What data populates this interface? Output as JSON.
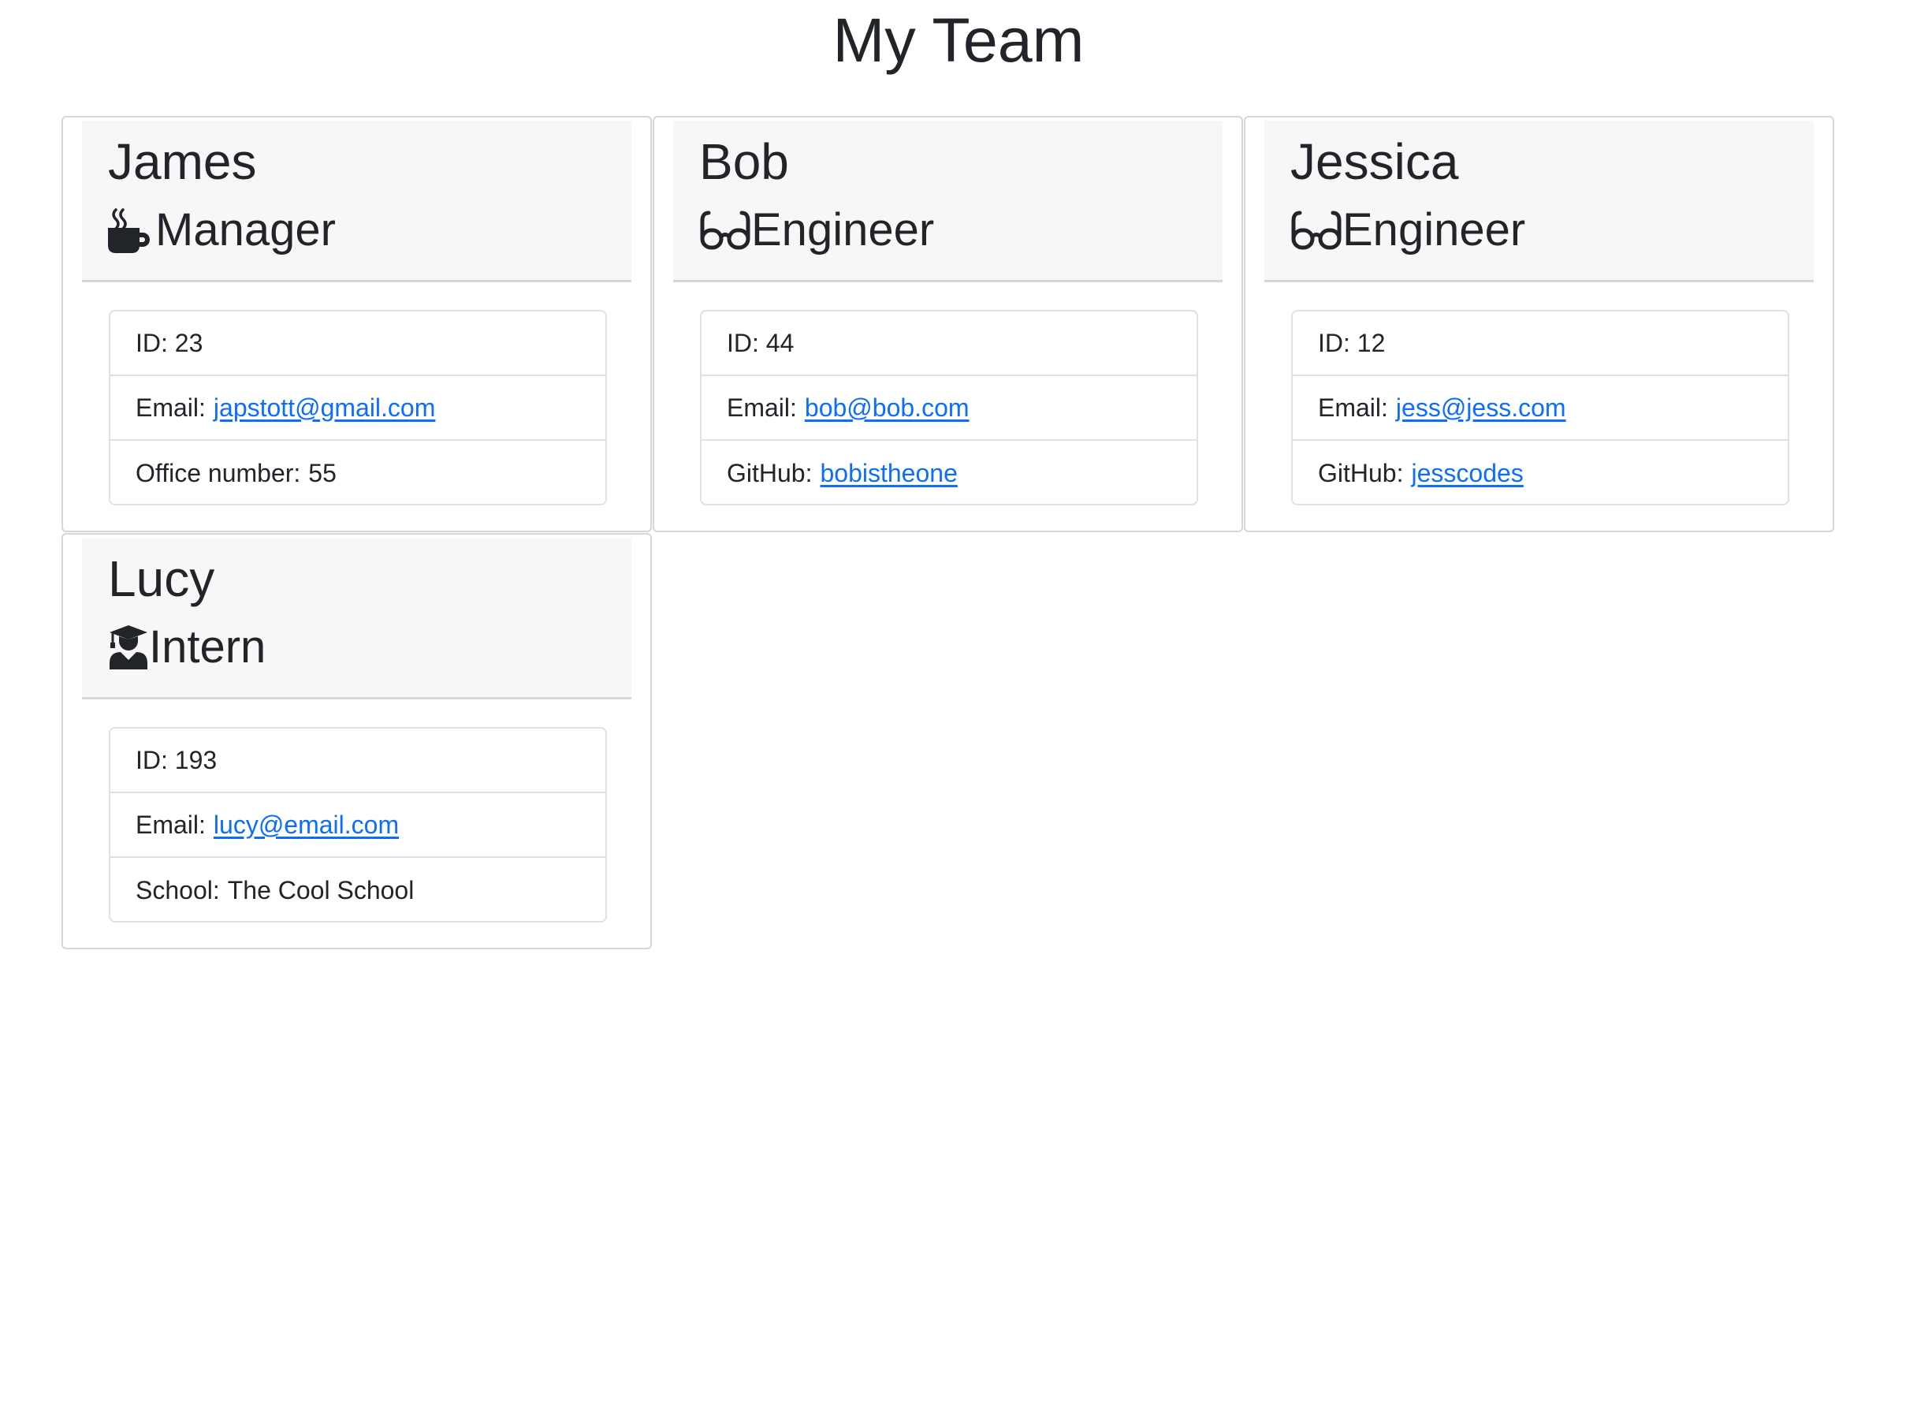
{
  "page": {
    "title": "My Team"
  },
  "colors": {
    "text": "#212529",
    "link": "#0d6efd",
    "card_border": "#d5d7da",
    "header_bg": "#f7f7f7"
  },
  "team": [
    {
      "name": "James",
      "role": "Manager",
      "icon": "mug-hot-icon",
      "id_text": "ID: 23",
      "email_label": "Email:",
      "email": "japstott@gmail.com",
      "extra_label": "Office number:",
      "extra_value": "55"
    },
    {
      "name": "Bob",
      "role": "Engineer",
      "icon": "glasses-icon",
      "id_text": "ID: 44",
      "email_label": "Email:",
      "email": "bob@bob.com",
      "extra_label": "GitHub:",
      "extra_value": "bobistheone"
    },
    {
      "name": "Jessica",
      "role": "Engineer",
      "icon": "glasses-icon",
      "id_text": "ID: 12",
      "email_label": "Email:",
      "email": "jess@jess.com",
      "extra_label": "GitHub:",
      "extra_value": "jesscodes"
    },
    {
      "name": "Lucy",
      "role": "Intern",
      "icon": "user-graduate-icon",
      "id_text": "ID: 193",
      "email_label": "Email:",
      "email": "lucy@email.com",
      "extra_label": "School:",
      "extra_value": "The Cool School"
    }
  ]
}
